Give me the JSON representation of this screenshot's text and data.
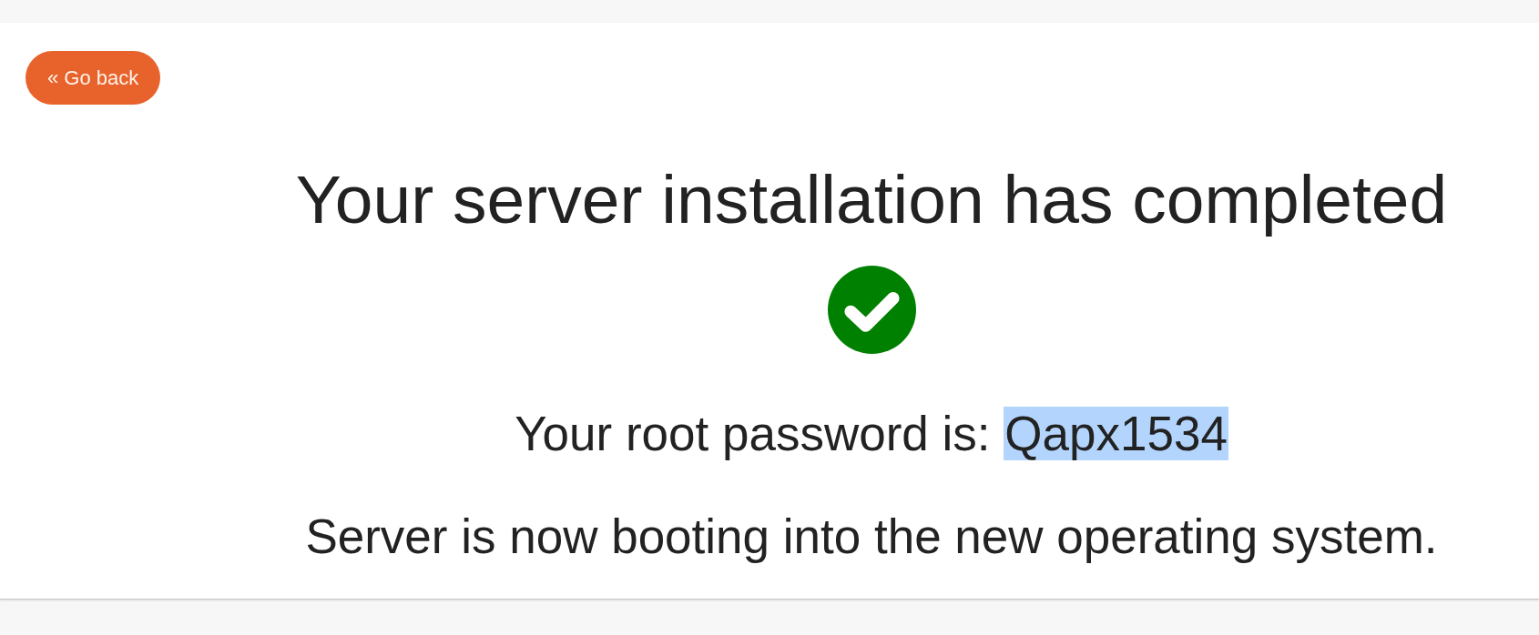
{
  "back_button": {
    "label": "« Go back"
  },
  "title": "Your server installation has completed",
  "password": {
    "label": "Your root password is:",
    "value": "Qapx1534",
    "highlighted": true
  },
  "message": "Server is now booting into the new operating system."
}
